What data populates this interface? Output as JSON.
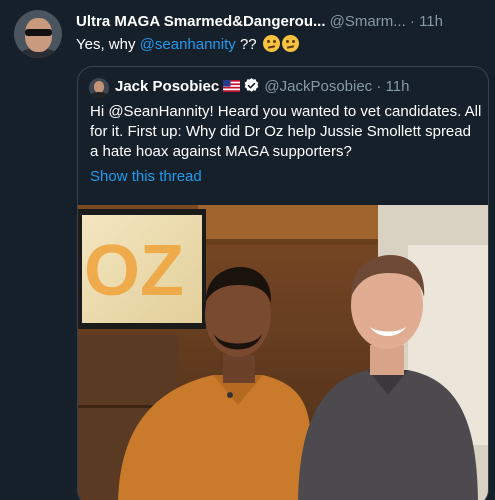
{
  "tweet": {
    "author_name": "Ultra MAGA Smarmed&Dangerou...",
    "author_handle": "@Smarm...",
    "separator": "·",
    "time": "11h",
    "text_prefix": "Yes, why",
    "mention": "@seanhannity",
    "text_suffix": "??"
  },
  "quoted": {
    "author_name": "Jack Posobiec",
    "author_handle": "@JackPosobiec",
    "separator": "·",
    "time": "11h",
    "text": "Hi @SeanHannity! Heard you wanted to vet candidates. All for it. First up: Why did Dr Oz help Jussie Smollett spread a hate hoax against MAGA supporters?",
    "show_thread": "Show this thread"
  },
  "icons": {
    "avatar": "user-avatar-icon",
    "emoji": "thinking-face-emoji-icon",
    "flag": "us-flag-icon",
    "verified": "verified-badge-icon"
  },
  "colors": {
    "background": "#15202b",
    "accent": "#1d9bf0",
    "secondary_text": "#8899a6",
    "border": "#38444d"
  }
}
